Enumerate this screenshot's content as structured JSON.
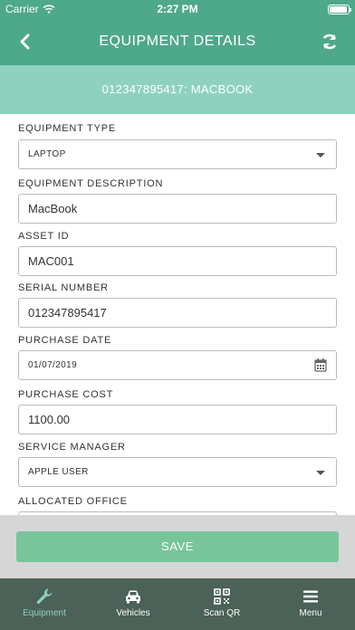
{
  "status_bar": {
    "carrier": "Carrier",
    "time": "2:27 PM"
  },
  "nav": {
    "title": "EQUIPMENT DETAILS",
    "back_icon": "chevron-left-icon",
    "refresh_icon": "refresh-icon"
  },
  "subheader": {
    "text": "012347895417: MACBOOK"
  },
  "form": {
    "equipment_type": {
      "label": "EQUIPMENT TYPE",
      "value": "LAPTOP"
    },
    "equipment_description": {
      "label": "EQUIPMENT DESCRIPTION",
      "value": "MacBook"
    },
    "asset_id": {
      "label": "ASSET ID",
      "value": "MAC001"
    },
    "serial_number": {
      "label": "SERIAL NUMBER",
      "value": "012347895417"
    },
    "purchase_date": {
      "label": "PURCHASE DATE",
      "value": "01/07/2019"
    },
    "purchase_cost": {
      "label": "PURCHASE COST",
      "value": "1100.00"
    },
    "service_manager": {
      "label": "SERVICE MANAGER",
      "value": "APPLE USER"
    },
    "allocated_office": {
      "label": "ALLOCATED OFFICE",
      "value": ""
    }
  },
  "save_label": "SAVE",
  "tabs": [
    {
      "label": "Equipment",
      "icon": "wrench-icon",
      "active": true
    },
    {
      "label": "Vehicles",
      "icon": "car-icon",
      "active": false
    },
    {
      "label": "Scan QR",
      "icon": "qr-code-icon",
      "active": false
    },
    {
      "label": "Menu",
      "icon": "menu-icon",
      "active": false
    }
  ],
  "colors": {
    "primary": "#4ea88a",
    "subheader": "#8fd1bf",
    "save_button": "#79c59b",
    "tab_bar": "#4c6157"
  }
}
